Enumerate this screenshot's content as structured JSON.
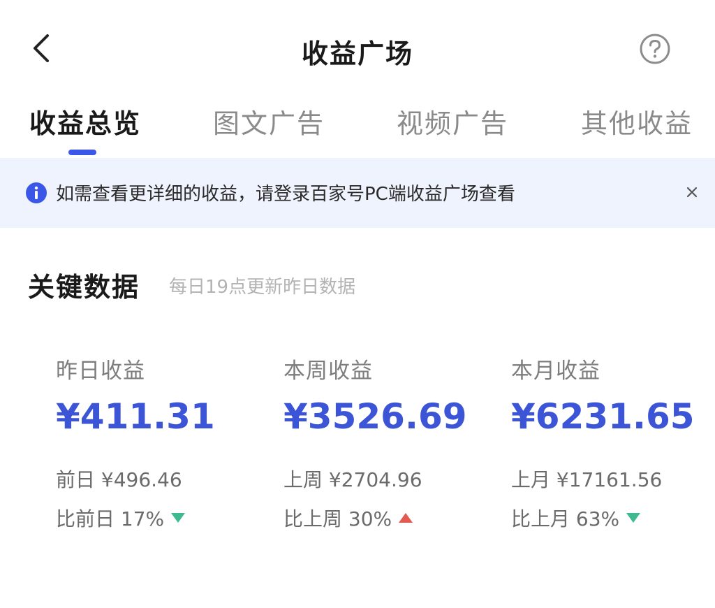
{
  "header": {
    "title": "收益广场",
    "back_icon": "chevron-left-icon",
    "help_icon": "question-circle-icon"
  },
  "tabs": [
    {
      "label": "收益总览",
      "active": true
    },
    {
      "label": "图文广告",
      "active": false
    },
    {
      "label": "视频广告",
      "active": false
    },
    {
      "label": "其他收益",
      "active": false
    }
  ],
  "notice": {
    "text": "如需查看更详细的收益，请登录百家号PC端收益广场查看",
    "icon": "info-circle-icon",
    "close_icon": "close-icon"
  },
  "section": {
    "title": "关键数据",
    "subtitle": "每日19点更新昨日数据"
  },
  "stats": [
    {
      "label": "昨日收益",
      "value": "¥411.31",
      "prev": "前日 ¥496.46",
      "compare": "比前日 17%",
      "trend": "down"
    },
    {
      "label": "本周收益",
      "value": "¥3526.69",
      "prev": "上周 ¥2704.96",
      "compare": "比上周 30%",
      "trend": "up"
    },
    {
      "label": "本月收益",
      "value": "¥6231.65",
      "prev": "上月 ¥17161.56",
      "compare": "比上月 63%",
      "trend": "down"
    }
  ],
  "colors": {
    "accent": "#3b57e8",
    "value_blue": "#3b55d6",
    "notice_bg": "#eef3fd",
    "trend_down": "#3fba8e",
    "trend_up": "#e25a52"
  }
}
